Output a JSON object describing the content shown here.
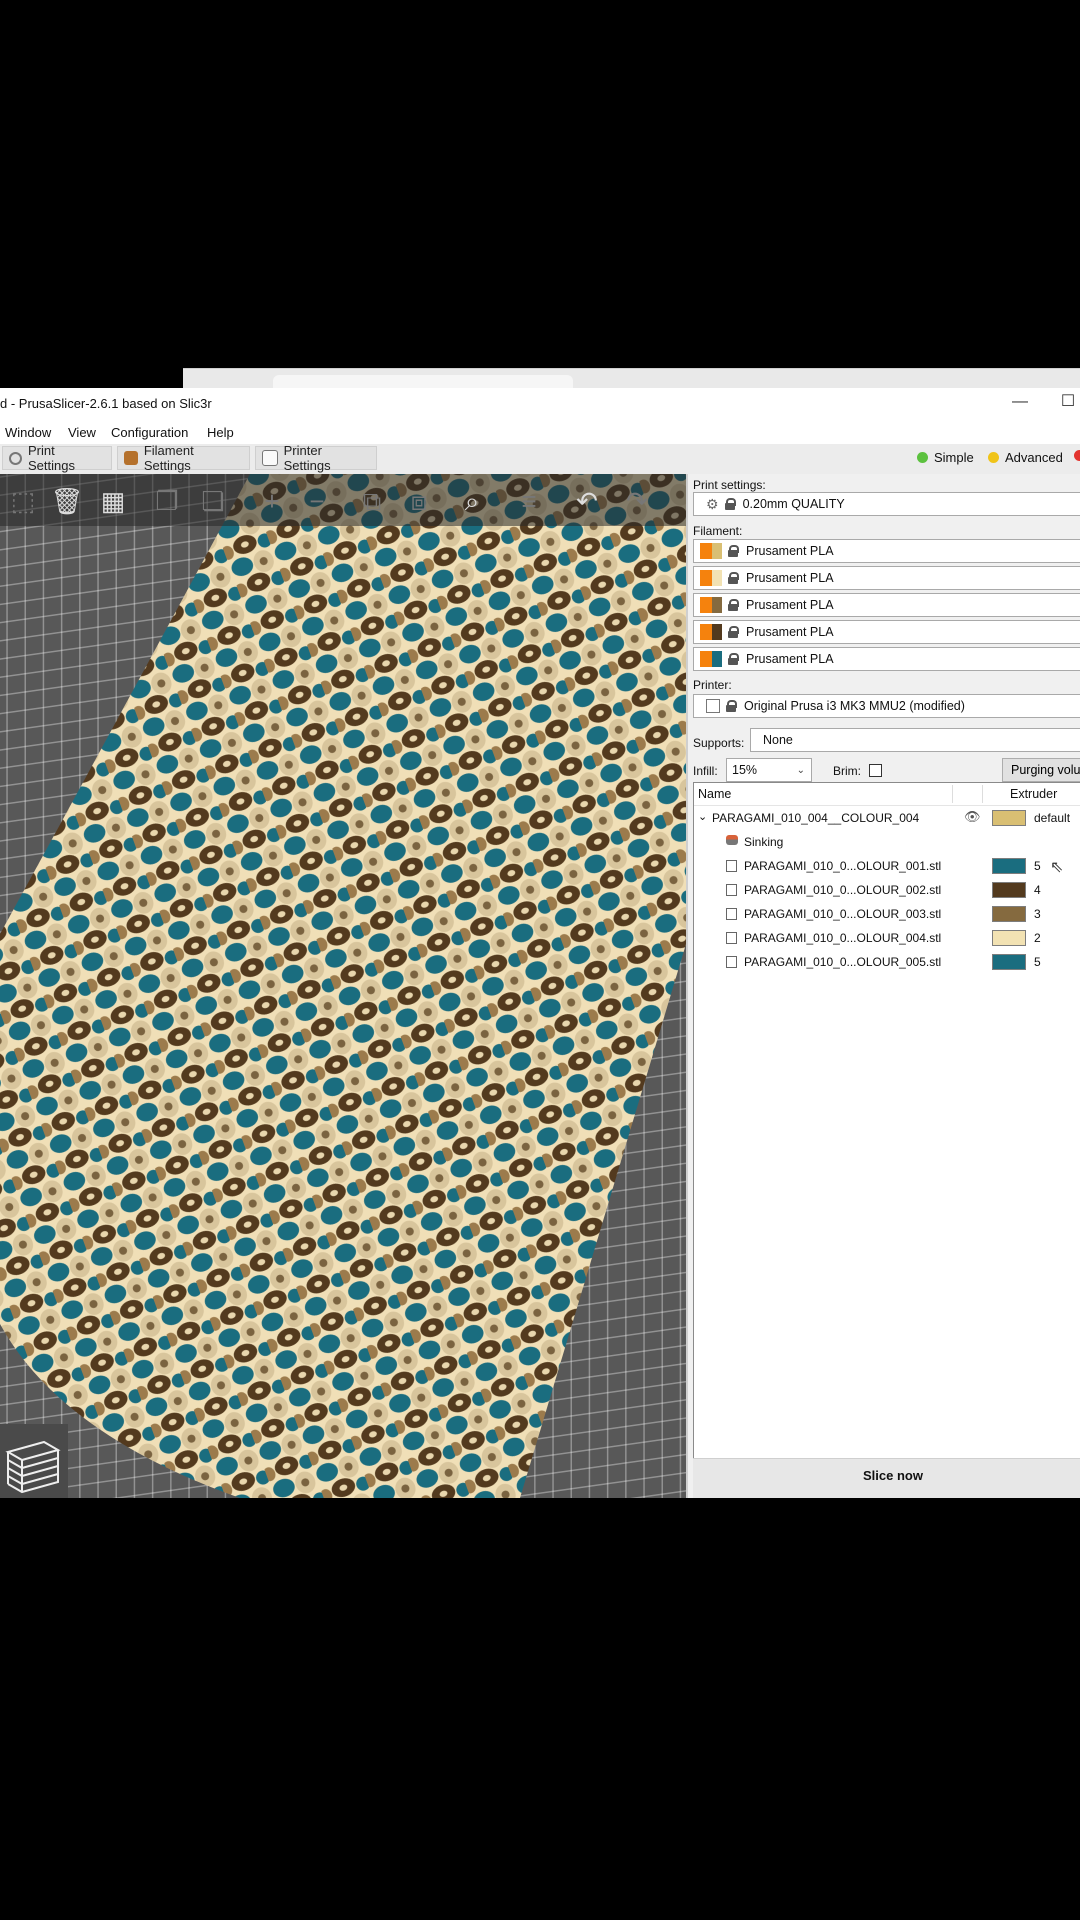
{
  "window": {
    "title": "d - PrusaSlicer-2.6.1 based on Slic3r",
    "minimize": "—",
    "maximize": "☐"
  },
  "menu": [
    "Window",
    "View",
    "Configuration",
    "Help"
  ],
  "tabs": {
    "print_settings": "Print Settings",
    "filament_settings": "Filament Settings",
    "printer_settings": "Printer Settings"
  },
  "modes": {
    "simple": "Simple",
    "advanced": "Advanced",
    "simple_color": "#5cc13f",
    "advanced_color": "#f0c419",
    "expert_color": "#e3342f"
  },
  "toolbar_icons": [
    "select-icon",
    "delete-icon",
    "arrange-icon",
    "copy-icon",
    "paste-icon",
    "add-instance-icon",
    "remove-instance-icon",
    "split-objects-icon",
    "split-parts-icon",
    "search-icon",
    "layer-editing-icon",
    "undo-icon",
    "redo-icon"
  ],
  "sidebar": {
    "print_settings_label": "Print settings:",
    "print_preset": "0.20mm QUALITY",
    "filament_label": "Filament:",
    "filaments": [
      {
        "name": "Prusament PLA",
        "color": "#d9bf73"
      },
      {
        "name": "Prusament PLA",
        "color": "#f2e2b3"
      },
      {
        "name": "Prusament PLA",
        "color": "#856a3f"
      },
      {
        "name": "Prusament PLA",
        "color": "#533a1e"
      },
      {
        "name": "Prusament PLA",
        "color": "#1a6d7f"
      }
    ],
    "filament_accent": "#f5820d",
    "printer_label": "Printer:",
    "printer_preset": "Original Prusa i3 MK3 MMU2 (modified)",
    "supports_label": "Supports:",
    "supports_value": "None",
    "infill_label": "Infill:",
    "infill_value": "15%",
    "brim_label": "Brim:",
    "purging_label": "Purging volu",
    "objects": {
      "col_name": "Name",
      "col_extruder": "Extruder",
      "root": {
        "name": "PARAGAMI_010_004__COLOUR_004",
        "extruder": "default",
        "color": "#d9bf73"
      },
      "sinking": "Sinking",
      "parts": [
        {
          "name": "PARAGAMI_010_0...OLOUR_001.stl",
          "extruder": "5",
          "color": "#1a6d7f"
        },
        {
          "name": "PARAGAMI_010_0...OLOUR_002.stl",
          "extruder": "4",
          "color": "#533a1e"
        },
        {
          "name": "PARAGAMI_010_0...OLOUR_003.stl",
          "extruder": "3",
          "color": "#856a3f"
        },
        {
          "name": "PARAGAMI_010_0...OLOUR_004.stl",
          "extruder": "2",
          "color": "#f2e2b3"
        },
        {
          "name": "PARAGAMI_010_0...OLOUR_005.stl",
          "extruder": "5",
          "color": "#1a6d7f"
        }
      ]
    },
    "slice_button": "Slice now"
  }
}
